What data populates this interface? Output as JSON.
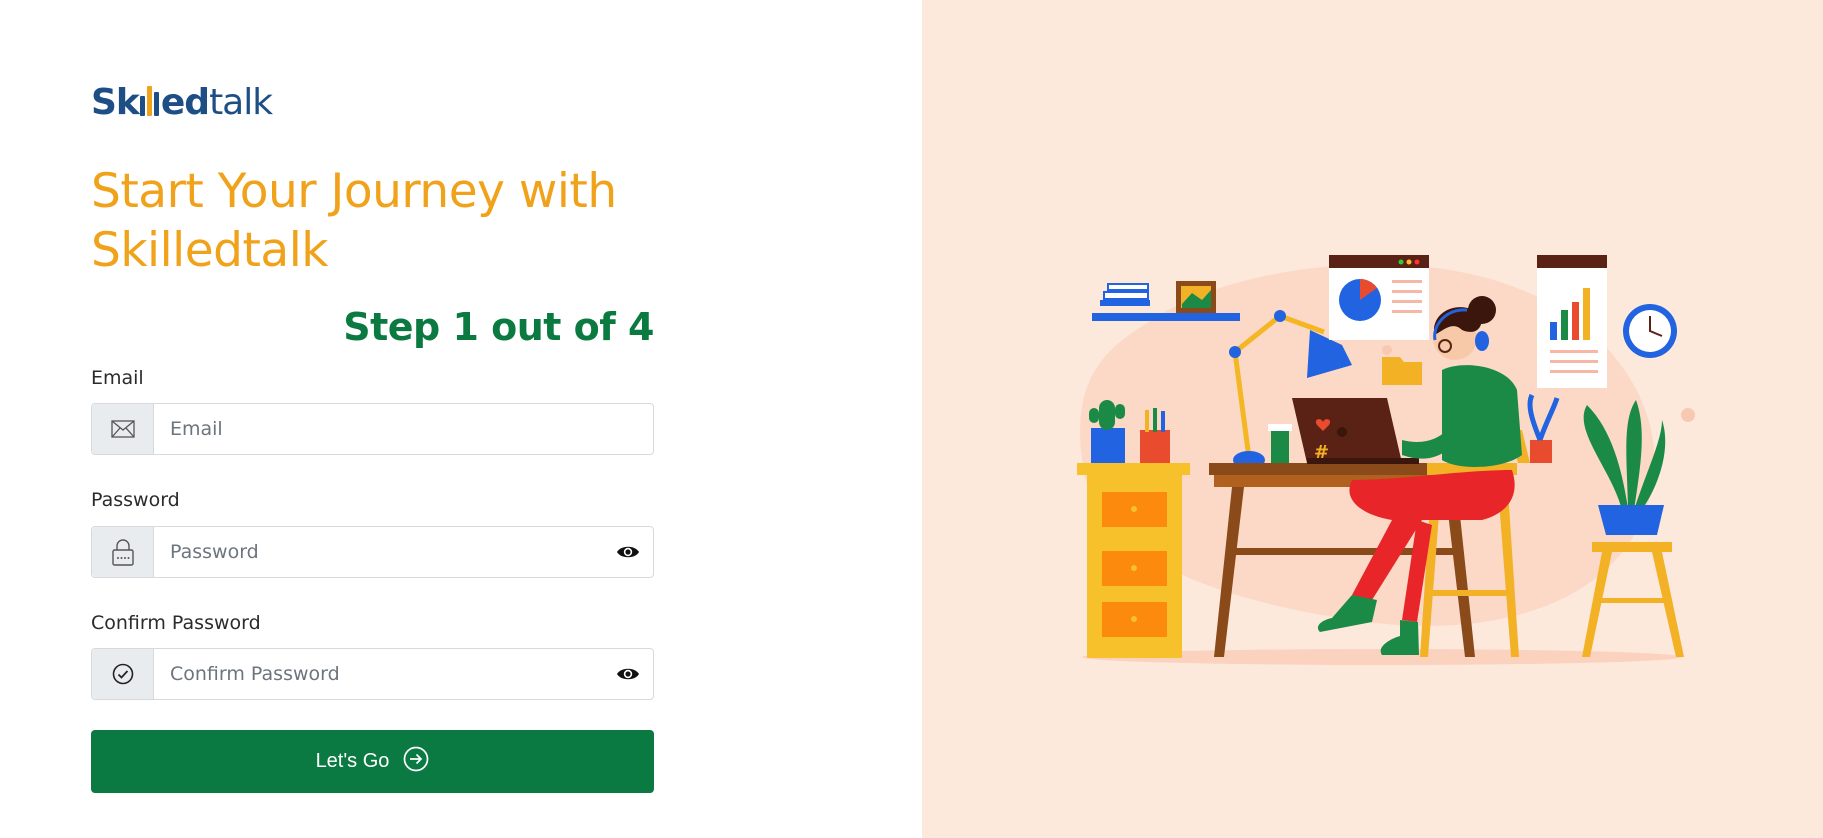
{
  "brand": {
    "part1": "Sk",
    "part2": "ed",
    "part3": "talk"
  },
  "headline": {
    "line1": "Start Your Journey with",
    "line2": "Skilledtalk"
  },
  "step": "Step 1 out of 4",
  "email": {
    "label": "Email",
    "placeholder": "Email",
    "icon": "envelope-icon"
  },
  "password": {
    "label": "Password",
    "placeholder": "Password",
    "icon": "lock-icon",
    "toggle_icon": "eye-icon"
  },
  "confirm": {
    "label": "Confirm Password",
    "placeholder": "Confirm Password",
    "icon": "check-circle-icon",
    "toggle_icon": "eye-icon"
  },
  "submit": {
    "label": "Let's Go",
    "icon": "arrow-right-circle-icon"
  },
  "colors": {
    "brand_blue": "#1d4f86",
    "accent_orange": "#f0a21b",
    "primary_green": "#0a7a42",
    "panel_bg": "#fde8dc"
  }
}
